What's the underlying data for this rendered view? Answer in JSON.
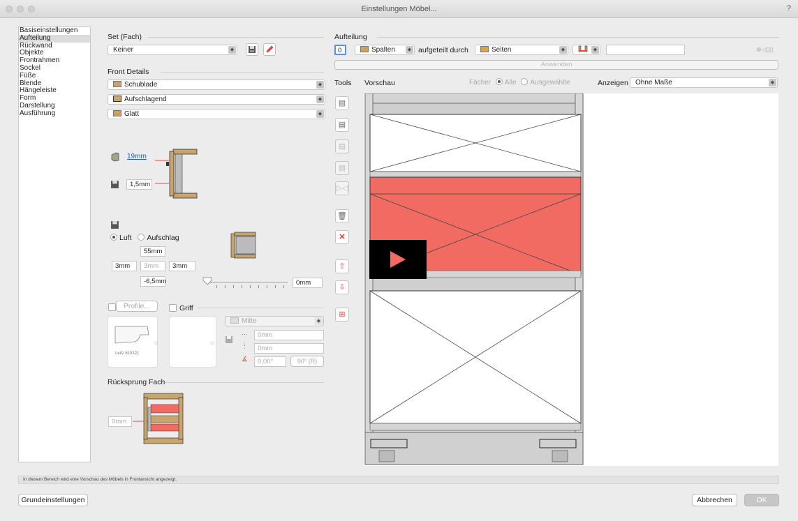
{
  "window": {
    "title": "Einstellungen Möbel...",
    "help": "?"
  },
  "sidebar": {
    "items": [
      "Basiseinstellungen",
      "Aufteilung",
      "Rückwand",
      "Objekte",
      "Frontrahmen",
      "Sockel",
      "Füße",
      "Blende",
      "Hängeleiste",
      "Form",
      "Darstellung",
      "Ausführung"
    ],
    "selected": "Aufteilung"
  },
  "set": {
    "heading": "Set (Fach)",
    "value": "Keiner"
  },
  "front_details": {
    "heading": "Front Details",
    "type": "Schublade",
    "mount": "Aufschlagend",
    "surface": "Glatt"
  },
  "thickness": {
    "value": "19mm",
    "gap": "1,5mm"
  },
  "placement": {
    "option1": "Luft",
    "option2": "Aufschlag",
    "top": "55mm",
    "left": "3mm",
    "middle": "3mm",
    "right": "3mm",
    "bottom": "-6,5mm",
    "slider_value": "0mm",
    "slider_fraction": 0.0
  },
  "profile": {
    "button": "Profile...",
    "griff": "Griff",
    "profile_name": "Leitz 619321",
    "position": "Mitte",
    "dist1": "0mm",
    "dist2": "0mm",
    "angle": "0,00°",
    "angle_btn": "90° (R)"
  },
  "rueck": {
    "heading": "Rücksprung Fach",
    "value": "0mm"
  },
  "aufteilung": {
    "heading": "Aufteilung",
    "count": "0",
    "type": "Spalten",
    "by_label": "aufgeteilt durch",
    "divider": "Seiten",
    "apply": "Anwenden"
  },
  "tools": {
    "heading": "Tools"
  },
  "preview": {
    "heading": "Vorschau",
    "faecher": "Fächer",
    "all": "Alle",
    "selected": "Ausgewählte",
    "show_label": "Anzeigen",
    "show_value": "Ohne Maße"
  },
  "status": "In diesem Bereich wird eine Vorschau des Möbels in Frontansicht angezeigt.",
  "footer": {
    "defaults": "Grundeinstellungen",
    "cancel": "Abbrechen",
    "ok": "OK"
  },
  "colors": {
    "highlight": "#f26b63",
    "frame": "#8a8a8a"
  }
}
